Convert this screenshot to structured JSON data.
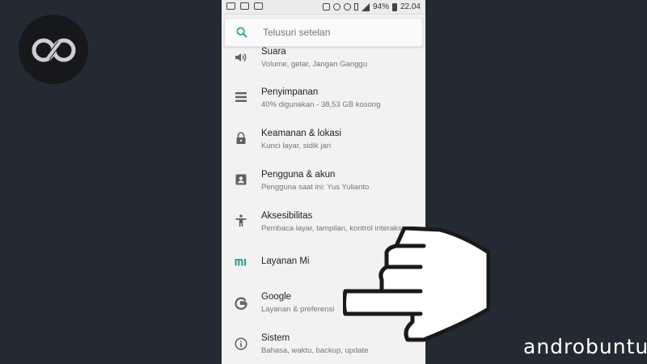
{
  "status_bar": {
    "battery": "94%",
    "time": "22.04"
  },
  "search": {
    "placeholder": "Telusuri setelan"
  },
  "settings": {
    "items": [
      {
        "icon": "volume-icon",
        "title": "Suara",
        "subtitle": "Volume, getar, Jangan Ganggu"
      },
      {
        "icon": "storage-icon",
        "title": "Penyimpanan",
        "subtitle": "40% digunakan - 38,53 GB kosong"
      },
      {
        "icon": "lock-icon",
        "title": "Keamanan & lokasi",
        "subtitle": "Kunci layar, sidik jari"
      },
      {
        "icon": "account-icon",
        "title": "Pengguna & akun",
        "subtitle": "Pengguna saat ini: Yus Yulianto"
      },
      {
        "icon": "accessibility-icon",
        "title": "Aksesibilitas",
        "subtitle": "Pembaca layar, tampilan, kontrol interaksi"
      },
      {
        "icon": "mi-icon",
        "title": "Layanan Mi",
        "subtitle": ""
      },
      {
        "icon": "google-icon",
        "title": "Google",
        "subtitle": "Layanan & preferensi"
      },
      {
        "icon": "info-icon",
        "title": "Sistem",
        "subtitle": "Bahasa, waktu, backup, update"
      }
    ]
  },
  "watermark": {
    "brand_text": "androbuntu"
  },
  "colors": {
    "background": "#242a33",
    "search_accent": "#26a69a",
    "mi_accent": "#2e9e8c"
  }
}
